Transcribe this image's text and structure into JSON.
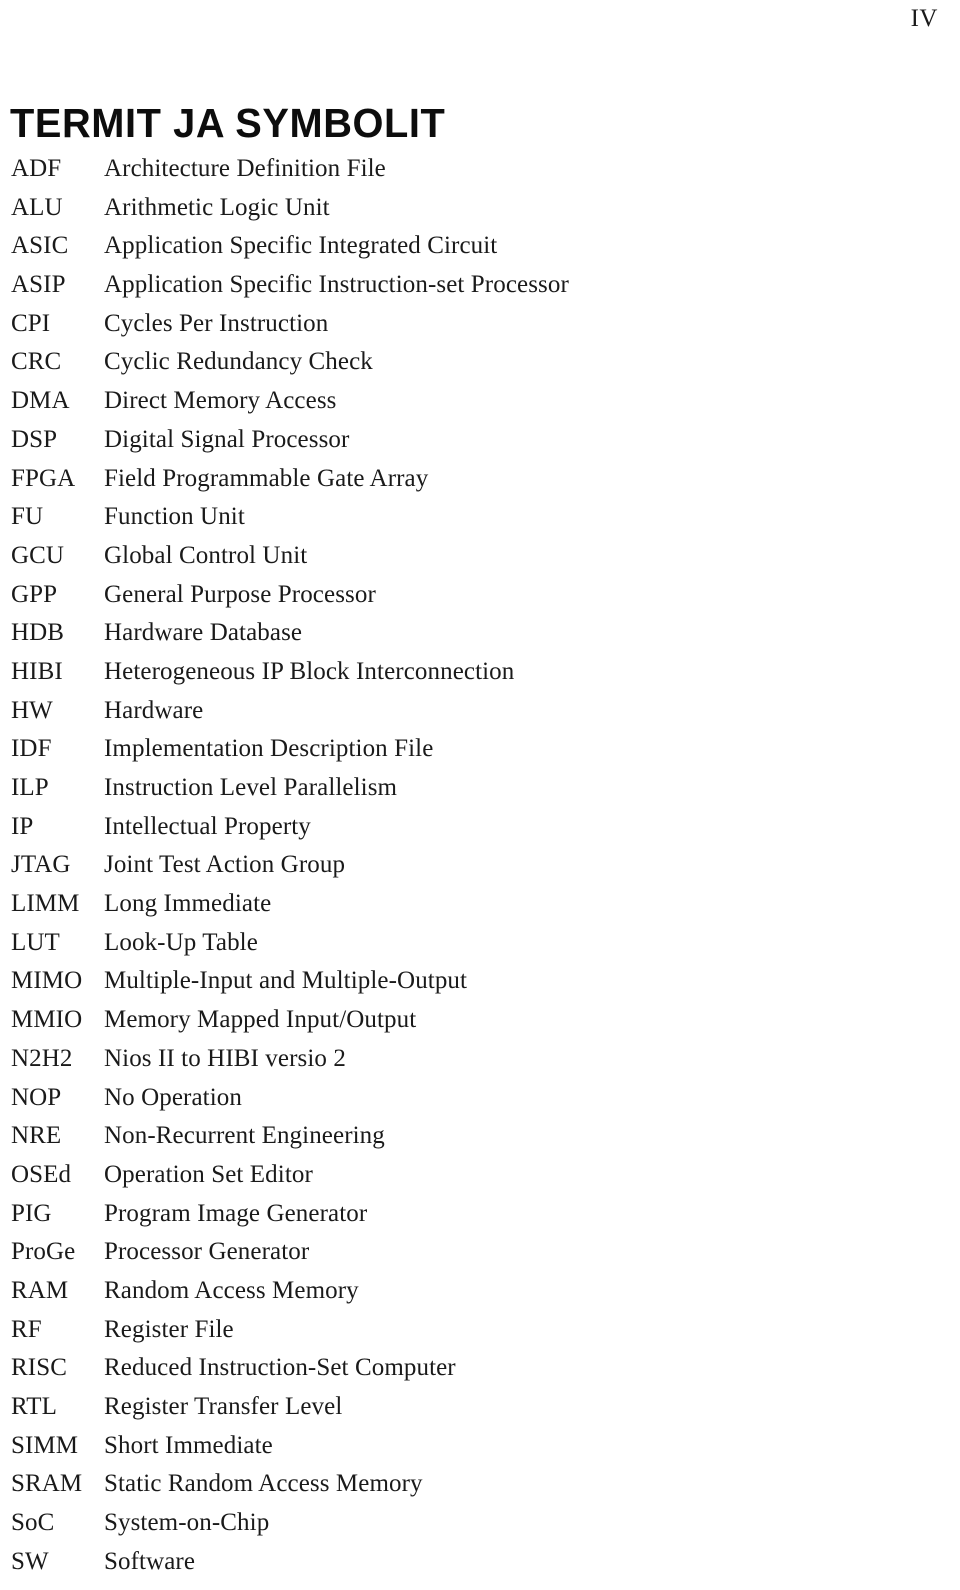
{
  "page": {
    "folio": "IV",
    "heading": "TERMIT JA SYMBOLIT"
  },
  "glossary": {
    "entries": [
      {
        "term": "ADF",
        "definition": "Architecture Definition File"
      },
      {
        "term": "ALU",
        "definition": "Arithmetic Logic Unit"
      },
      {
        "term": "ASIC",
        "definition": "Application Specific Integrated Circuit"
      },
      {
        "term": "ASIP",
        "definition": "Application Specific Instruction-set Processor"
      },
      {
        "term": "CPI",
        "definition": "Cycles Per Instruction"
      },
      {
        "term": "CRC",
        "definition": "Cyclic Redundancy Check"
      },
      {
        "term": "DMA",
        "definition": "Direct Memory Access"
      },
      {
        "term": "DSP",
        "definition": "Digital Signal Processor"
      },
      {
        "term": "FPGA",
        "definition": "Field Programmable Gate Array"
      },
      {
        "term": "FU",
        "definition": "Function Unit"
      },
      {
        "term": "GCU",
        "definition": "Global Control Unit"
      },
      {
        "term": "GPP",
        "definition": "General Purpose Processor"
      },
      {
        "term": "HDB",
        "definition": "Hardware Database"
      },
      {
        "term": "HIBI",
        "definition": "Heterogeneous IP Block Interconnection"
      },
      {
        "term": "HW",
        "definition": "Hardware"
      },
      {
        "term": "IDF",
        "definition": "Implementation Description File"
      },
      {
        "term": "ILP",
        "definition": "Instruction Level Parallelism"
      },
      {
        "term": "IP",
        "definition": "Intellectual Property"
      },
      {
        "term": "JTAG",
        "definition": "Joint Test Action Group"
      },
      {
        "term": "LIMM",
        "definition": "Long Immediate"
      },
      {
        "term": "LUT",
        "definition": "Look-Up Table"
      },
      {
        "term": "MIMO",
        "definition": "Multiple-Input and Multiple-Output"
      },
      {
        "term": "MMIO",
        "definition": "Memory Mapped Input/Output"
      },
      {
        "term": "N2H2",
        "definition": "Nios II to HIBI versio 2"
      },
      {
        "term": "NOP",
        "definition": "No Operation"
      },
      {
        "term": "NRE",
        "definition": "Non-Recurrent Engineering"
      },
      {
        "term": "OSEd",
        "definition": "Operation Set Editor"
      },
      {
        "term": "PIG",
        "definition": "Program Image Generator"
      },
      {
        "term": "ProGe",
        "definition": "Processor Generator"
      },
      {
        "term": "RAM",
        "definition": "Random Access Memory"
      },
      {
        "term": "RF",
        "definition": "Register File"
      },
      {
        "term": "RISC",
        "definition": "Reduced Instruction-Set Computer"
      },
      {
        "term": "RTL",
        "definition": "Register Transfer Level"
      },
      {
        "term": "SIMM",
        "definition": "Short Immediate"
      },
      {
        "term": "SRAM",
        "definition": "Static Random Access Memory"
      },
      {
        "term": "SoC",
        "definition": "System-on-Chip"
      },
      {
        "term": "SW",
        "definition": "Software"
      }
    ]
  }
}
